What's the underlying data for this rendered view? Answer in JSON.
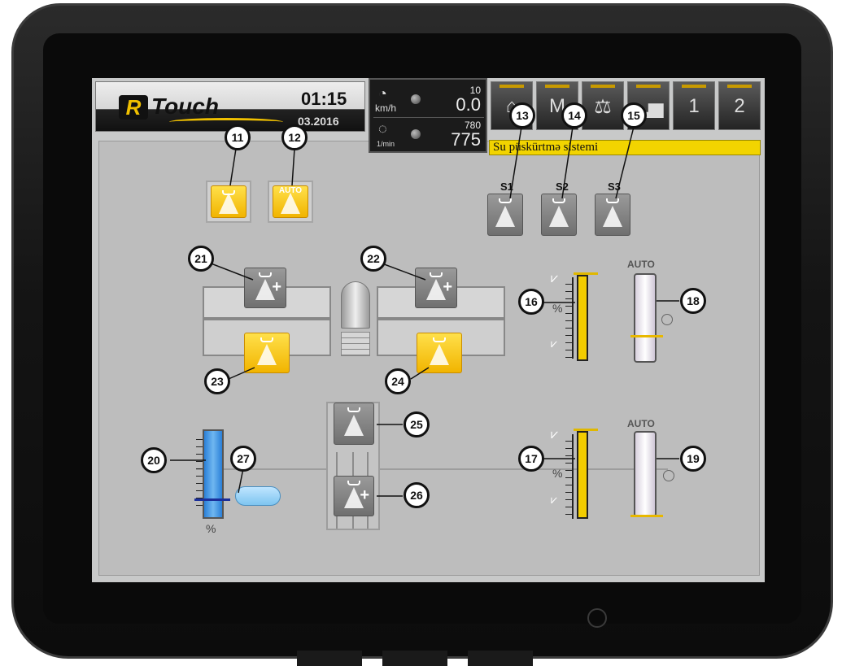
{
  "header": {
    "logo_r": "R",
    "logo_text": "Touch",
    "time": "01:15",
    "date": "03.2016"
  },
  "gauges": {
    "speed_unit": "km/h",
    "speed_target": "10",
    "speed_value": "0.0",
    "rpm_unit": "1/min",
    "rpm_target": "780",
    "rpm_value": "775"
  },
  "tabs": [
    {
      "icon": "home-icon",
      "glyph": "⌂"
    },
    {
      "icon": "machine-icon",
      "glyph": "M"
    },
    {
      "icon": "scale-icon",
      "glyph": "⚖"
    },
    {
      "icon": "bar-chart-icon",
      "glyph": "▂▅"
    },
    {
      "icon": "page-1-icon",
      "glyph": "1"
    },
    {
      "icon": "page-2-icon",
      "glyph": "2"
    }
  ],
  "status": {
    "title": "Su püskürtmə sistemi"
  },
  "sections": {
    "s1": "S1",
    "s2": "S2",
    "s3": "S3"
  },
  "controls": {
    "auto_button_text": "AUTO",
    "auto_label_upper": "AUTO",
    "auto_label_lower": "AUTO",
    "percent": "%"
  },
  "callouts": [
    "11",
    "12",
    "13",
    "14",
    "15",
    "16",
    "17",
    "18",
    "19",
    "20",
    "21",
    "22",
    "23",
    "24",
    "25",
    "26",
    "27"
  ],
  "colors": {
    "active_button": "#f1b400",
    "inactive_button": "#7a7a7a",
    "status_bar": "#f2d400",
    "water_tank": "#2a7fd8"
  }
}
